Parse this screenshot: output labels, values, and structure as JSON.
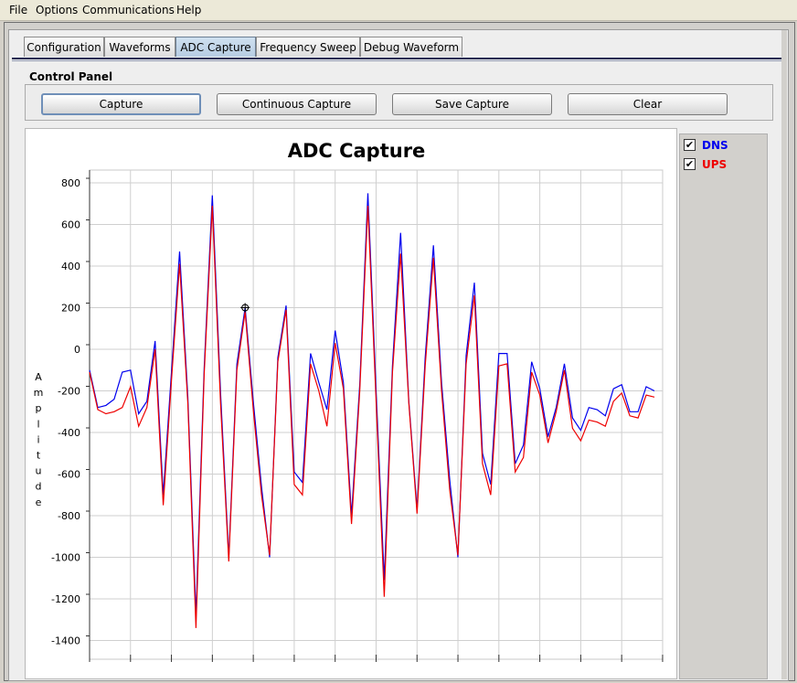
{
  "menu": {
    "file": "File",
    "options": "Options",
    "communications": "Communications",
    "help": "Help"
  },
  "tabs": [
    {
      "label": "Configuration"
    },
    {
      "label": "Waveforms"
    },
    {
      "label": "ADC Capture",
      "active": true
    },
    {
      "label": "Frequency Sweep"
    },
    {
      "label": "Debug Waveform"
    }
  ],
  "control_panel": {
    "title": "Control Panel",
    "capture_label": "Capture",
    "continuous_capture_label": "Continuous Capture",
    "save_capture_label": "Save Capture",
    "clear_label": "Clear"
  },
  "legend": {
    "items": [
      {
        "label": "DNS",
        "checked": true,
        "color": "#0000ee",
        "check_glyph": "✔"
      },
      {
        "label": "UPS",
        "checked": true,
        "color": "#ee0000",
        "check_glyph": "✔"
      }
    ]
  },
  "colors": {
    "dns": "#0000ee",
    "ups": "#ee0000",
    "active_tab": "#b8cce4"
  },
  "chart_data": {
    "type": "line",
    "title": "ADC Capture",
    "ylabel": "Amplitude",
    "xlabel": "",
    "ylim": [
      -1450,
      850
    ],
    "xlim": [
      0,
      69
    ],
    "grid": true,
    "legend_placement": "right",
    "y_ticks": [
      800,
      600,
      400,
      200,
      0,
      -200,
      -400,
      -600,
      -800,
      -1000,
      -1200,
      -1400
    ],
    "y_tick_labels": [
      "800",
      "600",
      "400",
      "200",
      "0",
      "-200",
      "-400",
      "-600",
      "-800",
      "-1000",
      "-1200",
      "-1400"
    ],
    "x_gridlines": [
      5,
      10,
      15,
      20,
      25,
      30,
      35,
      40,
      45,
      50,
      55,
      60,
      65,
      70
    ],
    "series": [
      {
        "name": "DNS",
        "color": "#0000ee",
        "x": [
          0,
          1,
          2,
          3,
          4,
          5,
          6,
          7,
          8,
          9,
          10,
          11,
          12,
          13,
          14,
          15,
          16,
          17,
          18,
          19,
          20,
          21,
          22,
          23,
          24,
          25,
          26,
          27,
          28,
          29,
          30,
          31,
          32,
          33,
          34,
          35,
          36,
          37,
          38,
          39,
          40,
          41,
          42,
          43,
          44,
          45,
          46,
          47,
          48,
          49,
          50,
          51,
          52,
          53,
          54,
          55,
          56,
          57,
          58,
          59,
          60,
          61,
          62,
          63,
          64,
          65,
          66,
          67,
          68,
          69
        ],
        "values": [
          -100,
          -280,
          -270,
          -240,
          -110,
          -100,
          -310,
          -250,
          40,
          -700,
          -110,
          470,
          -230,
          -1280,
          -90,
          740,
          -210,
          -1000,
          -70,
          200,
          -250,
          -660,
          -1000,
          -40,
          210,
          -590,
          -640,
          -20,
          -160,
          -290,
          90,
          -160,
          -800,
          -170,
          750,
          -200,
          -1110,
          -80,
          560,
          -250,
          -770,
          -40,
          500,
          -160,
          -630,
          -1000,
          -30,
          320,
          -500,
          -650,
          -20,
          -20,
          -550,
          -460,
          -60,
          -190,
          -420,
          -280,
          -70,
          -330,
          -390,
          -280,
          -290,
          -320,
          -190,
          -170,
          -300,
          -300,
          -180,
          -200
        ]
      },
      {
        "name": "UPS",
        "color": "#ee0000",
        "x": [
          0,
          1,
          2,
          3,
          4,
          5,
          6,
          7,
          8,
          9,
          10,
          11,
          12,
          13,
          14,
          15,
          16,
          17,
          18,
          19,
          20,
          21,
          22,
          23,
          24,
          25,
          26,
          27,
          28,
          29,
          30,
          31,
          32,
          33,
          34,
          35,
          36,
          37,
          38,
          39,
          40,
          41,
          42,
          43,
          44,
          45,
          46,
          47,
          48,
          49,
          50,
          51,
          52,
          53,
          54,
          55,
          56,
          57,
          58,
          59,
          60,
          61,
          62,
          63,
          64,
          65,
          66,
          67,
          68,
          69
        ],
        "values": [
          -110,
          -290,
          -310,
          -300,
          -280,
          -180,
          -370,
          -280,
          0,
          -750,
          -150,
          410,
          -260,
          -1340,
          -120,
          690,
          -260,
          -1020,
          -100,
          180,
          -290,
          -700,
          -990,
          -60,
          190,
          -650,
          -700,
          -70,
          -200,
          -370,
          30,
          -190,
          -840,
          -200,
          690,
          -250,
          -1190,
          -110,
          460,
          -260,
          -790,
          -80,
          440,
          -200,
          -680,
          -990,
          -70,
          260,
          -550,
          -700,
          -80,
          -70,
          -590,
          -520,
          -110,
          -220,
          -450,
          -300,
          -100,
          -380,
          -440,
          -340,
          -350,
          -370,
          -250,
          -210,
          -320,
          -330,
          -220,
          -230
        ]
      }
    ]
  }
}
